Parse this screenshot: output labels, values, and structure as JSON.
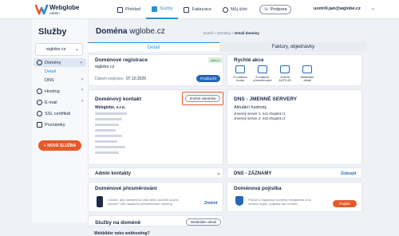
{
  "header": {
    "brand": "Webglobe",
    "brand_sub": "Admin",
    "nav": [
      {
        "label": "Přehled",
        "active": false
      },
      {
        "label": "Služby",
        "active": true
      },
      {
        "label": "Fakturace",
        "active": false
      },
      {
        "label": "Můj účet",
        "active": false
      }
    ],
    "support_label": "Podpora",
    "user_email": "uzetrili.jan@wglobe.cz"
  },
  "sidebar": {
    "title": "Služby",
    "domain_value": "wglobe.cz",
    "items": [
      {
        "label": "Domény",
        "active": true
      },
      {
        "label": "Detail",
        "sub": true,
        "active": true
      },
      {
        "label": "DNS",
        "sub": true
      },
      {
        "label": "Hosting"
      },
      {
        "label": "E-mail"
      },
      {
        "label": "SSL certifikát"
      },
      {
        "label": "Poznámky"
      }
    ],
    "new_service_label": "+ NOVÁ SLUŽBA"
  },
  "main": {
    "title_prefix": "Doména",
    "title_domain": "wglobe.cz",
    "breadcrumb": {
      "home": "Domů",
      "sep1": ">",
      "domains": "Domény",
      "sep2": ">",
      "current": "Detail domény"
    },
    "tabs": [
      {
        "label": "Detail",
        "active": true
      },
      {
        "label": "Faktury, objednávky",
        "active": false
      }
    ],
    "registration": {
      "title": "Doménové registrace",
      "badge": "aktivní",
      "domain": "wglobe.cz",
      "expiry_label": "Datum expirace:",
      "expiry_value": "07.10.2025",
      "renew_button": "Prodloužit"
    },
    "quick_actions": {
      "title": "Rychlé akce",
      "items": [
        "E-mailová fronta",
        "E-mailové přesměrování",
        "Změnit AUTH-ID",
        "Webbilder detail"
      ]
    },
    "contact": {
      "title": "Doménový kontakt",
      "change_owner_button": "Změnit vlastníka",
      "company": "Webglobe, s.r.o."
    },
    "dns": {
      "title": "DNS - JMENNÉ SERVERY",
      "current_label": "Aktuální hodnoty",
      "servers": [
        "Jmenný server 1: ns1.shoptet.cz",
        "Jmenný server 2: ns2.shoptet.cz"
      ]
    },
    "admin_contacts": {
      "title": "Admin kontakty"
    },
    "dns_records": {
      "title": "DNS - ZÁZNAMY",
      "link": "Zobrazit"
    },
    "redirect": {
      "title": "Doménové přesměrování",
      "text": "Chcete, aby návštěvníci vaší webu skončili na jiné adrese? Zde nastavíte přesměrování domény.",
      "link": "Změnit"
    },
    "protection": {
      "title": "Doménová pojistka",
      "text": "Pokud si registrace domény nezaplatíte a ke zrušení dojde, pojistka vás ochrání.",
      "button": "Pojistit"
    },
    "services": {
      "title": "Služby na doméně",
      "subtitle": "Webbilder nebo webhosting?",
      "button": "Webbilder detail"
    }
  },
  "colors": {
    "accent": "#2a8fd6",
    "primary_button": "#2466b8",
    "orange": "#e45a2b",
    "success": "#2e8b3a"
  }
}
